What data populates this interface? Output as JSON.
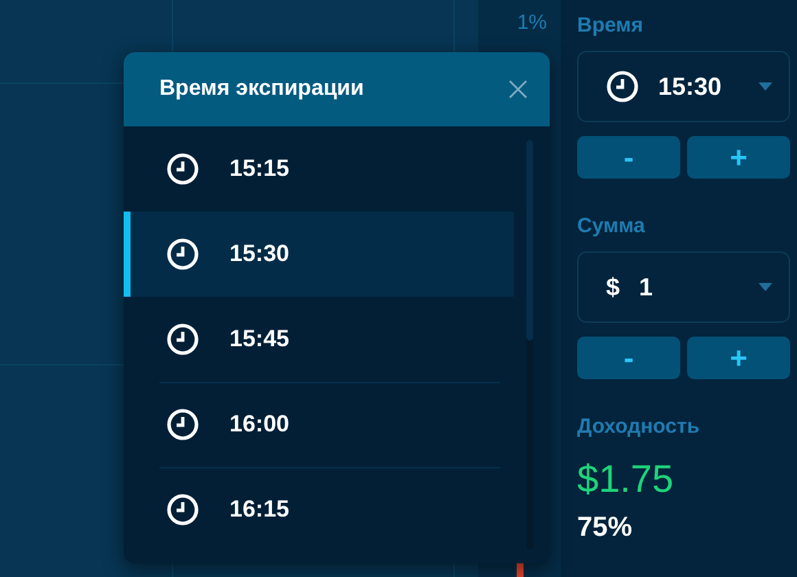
{
  "chart": {
    "axis_label": "1%"
  },
  "expiration_popup": {
    "title": "Время экспирации",
    "items": [
      {
        "time": "15:15",
        "selected": false
      },
      {
        "time": "15:30",
        "selected": true
      },
      {
        "time": "15:45",
        "selected": false
      },
      {
        "time": "16:00",
        "selected": false
      },
      {
        "time": "16:15",
        "selected": false
      }
    ]
  },
  "panel": {
    "time": {
      "label": "Время",
      "value": "15:30",
      "decrease": "-",
      "increase": "+"
    },
    "amount": {
      "label": "Сумма",
      "currency": "$",
      "value": "1",
      "decrease": "-",
      "increase": "+"
    },
    "profit": {
      "label": "Доходность",
      "amount": "$1.75",
      "percent": "75%"
    }
  }
}
